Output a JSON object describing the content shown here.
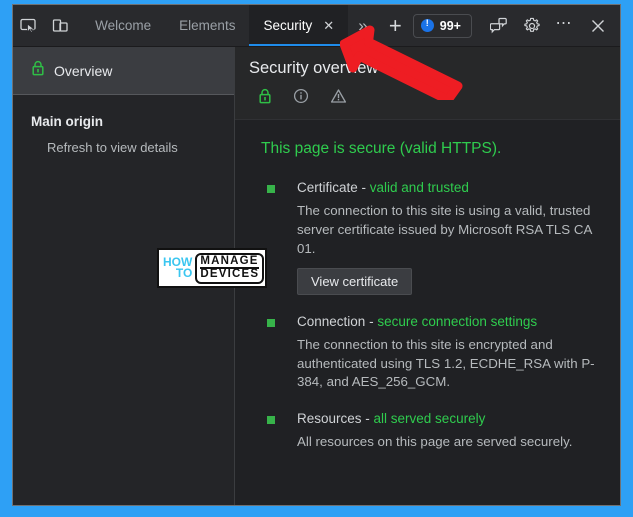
{
  "window": {
    "frame_color": "#2ea0f5",
    "background": "#202124"
  },
  "toolbar": {
    "inspect_icon": "inspect-cursor-icon",
    "device_icon": "device-toolbar-icon",
    "tabs": [
      {
        "label": "Welcome",
        "active": false,
        "closable": false
      },
      {
        "label": "Elements",
        "active": false,
        "closable": false
      },
      {
        "label": "Security",
        "active": true,
        "closable": true,
        "close_glyph": "✕"
      }
    ],
    "more_tabs_glyph": "»",
    "more_tabs_name": "more-tabs-button",
    "new_tab_glyph": "+",
    "issues": {
      "count": "99+",
      "badge_color": "#1a73e8"
    },
    "feedback_icon": "feedback-chat-icon",
    "settings_icon": "gear-icon",
    "more_options_glyph": "⋯",
    "close_glyph": "✕"
  },
  "sidebar": {
    "overview": {
      "label": "Overview",
      "icon": "green-lock-icon",
      "selected": true
    },
    "section": {
      "header": "Main origin",
      "items": [
        {
          "label": "Refresh to view details"
        }
      ]
    }
  },
  "main": {
    "title": "Security overview",
    "summary_icons": [
      {
        "name": "lock-icon",
        "state": "secure",
        "color": "#2fcc4e"
      },
      {
        "name": "info-icon",
        "state": "info",
        "color": "#9aa0a6"
      },
      {
        "name": "warning-triangle-icon",
        "state": "warning",
        "color": "#9aa0a6"
      }
    ],
    "verdict": "This page is secure (valid HTTPS).",
    "verdict_color": "#2fcc4e",
    "sections": [
      {
        "label": "Certificate",
        "separator": " - ",
        "status": "valid and trusted",
        "status_color": "#2fcc4e",
        "body": "The connection to this site is using a valid, trusted server certificate issued by Microsoft RSA TLS CA 01.",
        "button": "View certificate"
      },
      {
        "label": "Connection",
        "separator": " - ",
        "status": "secure connection settings",
        "status_color": "#2fcc4e",
        "body": "The connection to this site is encrypted and authenticated using TLS 1.2, ECDHE_RSA with P-384, and AES_256_GCM.",
        "button": null
      },
      {
        "label": "Resources",
        "separator": " - ",
        "status": "all served securely",
        "status_color": "#2fcc4e",
        "body": "All resources on this page are served securely.",
        "button": null
      }
    ]
  },
  "watermark": {
    "how": "HOW",
    "to": "TO",
    "manage": "MANAGE",
    "devices": "DEVICES",
    "accent": "#3ac6f0"
  },
  "annotation": {
    "arrow_color": "#ee1d23",
    "points_at": "more-tabs-button"
  }
}
